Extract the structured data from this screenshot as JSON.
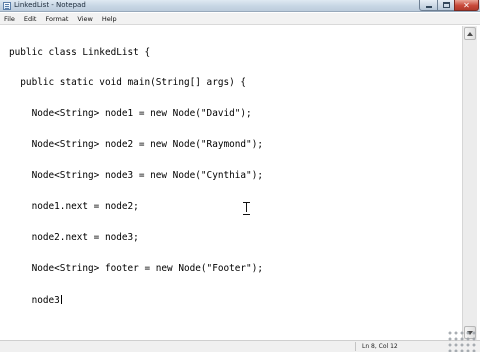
{
  "window": {
    "title": "LinkedList - Notepad",
    "buttons": {
      "minimize": "minimize",
      "maximize": "maximize",
      "close": "✕"
    }
  },
  "menu": {
    "items": [
      "File",
      "Edit",
      "Format",
      "View",
      "Help"
    ]
  },
  "editor": {
    "lines": [
      "public class LinkedList {",
      "  public static void main(String[] args) {",
      "    Node<String> node1 = new Node(\"David\");",
      "    Node<String> node2 = new Node(\"Raymond\");",
      "    Node<String> node3 = new Node(\"Cynthia\");",
      "    node1.next = node2;",
      "    node2.next = node3;",
      "    Node<String> footer = new Node(\"Footer\");",
      "    node3"
    ]
  },
  "status": {
    "position": "Ln 8, Col 12"
  },
  "icons": {
    "app": "notepad-icon",
    "scroll_up": "scroll-up-arrow-icon",
    "scroll_down": "scroll-down-arrow-icon",
    "resize": "resize-grip-icon",
    "cursor": "text-cursor-icon"
  },
  "colors": {
    "titlebar": "#c7d6e4",
    "close_button": "#c8493a",
    "editor_background": "#ffffff",
    "text": "#000000"
  }
}
